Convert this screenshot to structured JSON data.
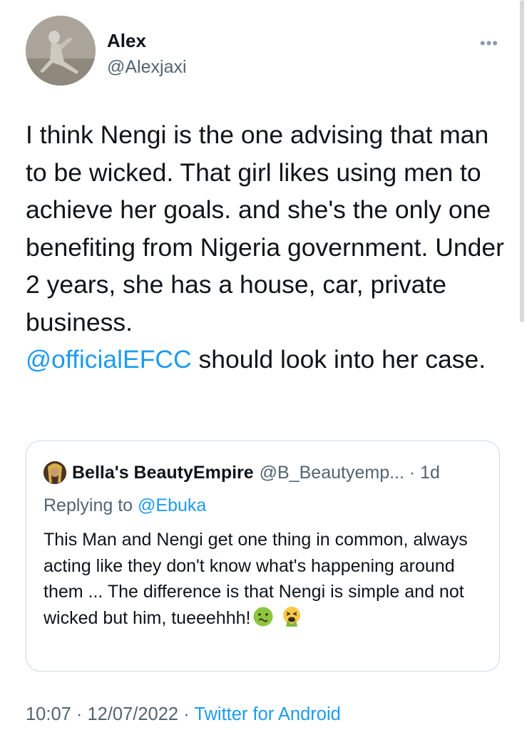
{
  "author": {
    "name": "Alex",
    "handle": "@Alexjaxi"
  },
  "more_icon": "more-horizontal-icon",
  "tweet": {
    "text_before": "I think Nengi is the  one advising that man to be wicked. That girl likes using men to achieve her goals. and she's the only one benefiting from Nigeria government. Under 2 years, she has a house, car, private business.\n",
    "mention": "@officialEFCC",
    "text_after": " should look into her case."
  },
  "quote": {
    "name": "Bella's BeautyEmpire",
    "handle": "@B_Beautyemp... · 1d",
    "replying_prefix": "Replying to ",
    "replying_to": "@Ebuka",
    "text": "This Man and Nengi get one thing in common, always acting like they don't know what's happening around them ... The difference is that Nengi is simple and not wicked but him, tueeehhh!",
    "emojis": [
      "nauseated-face-icon",
      "vomiting-face-icon"
    ]
  },
  "meta": {
    "time_date": "10:07 · 12/07/2022 · ",
    "source": "Twitter for Android"
  },
  "colors": {
    "link": "#1d9bf0",
    "secondary": "#536471",
    "text": "#0f1419"
  }
}
